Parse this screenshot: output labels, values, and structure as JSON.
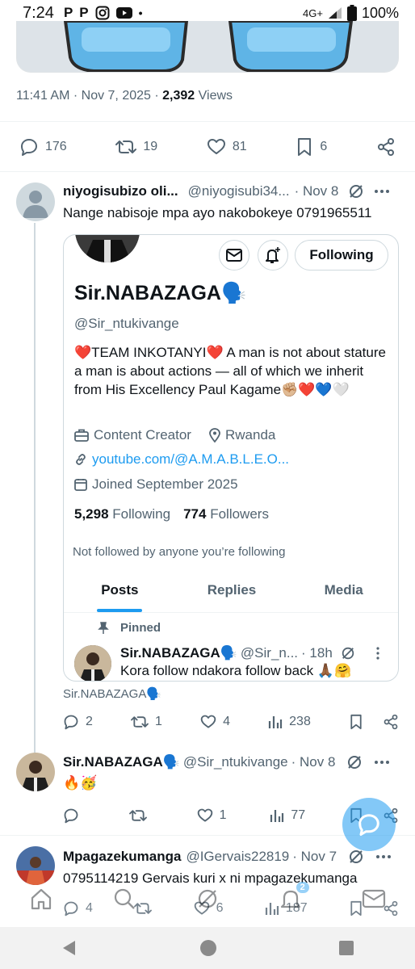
{
  "status_bar": {
    "time": "7:24",
    "app_icons": [
      "P",
      "P",
      "instagram-icon",
      "youtube-icon",
      "•"
    ],
    "network": "4G+",
    "battery": "100%"
  },
  "main_tweet": {
    "time": "11:41 AM · Nov 7, 2025 · ",
    "views_count": "2,392",
    "views_label": "Views",
    "actions": {
      "replies": "176",
      "retweets": "19",
      "likes": "81",
      "bookmarks": "6"
    }
  },
  "reply1": {
    "name": "niyogisubizo oli...",
    "handle": "@niyogisubi34...",
    "date": "· Nov 8",
    "text": "Nange nabisoje mpa ayo nakobokeye 0791965511",
    "card": {
      "following_button": "Following",
      "name": "Sir.NABAZAGA🗣️",
      "handle": "@Sir_ntukivange",
      "bio": "❤️TEAM INKOTANYI❤️  A man is not about stature a man is about actions — all of which we inherit from His Excellency Paul Kagame✊🏼❤️💙🤍",
      "category": "Content Creator",
      "location": "Rwanda",
      "link": "youtube.com/@A.M.A.B.L.E.O...",
      "joined": "Joined September 2025",
      "following_count": "5,298",
      "following_label": "Following",
      "followers_count": "774",
      "followers_label": "Followers",
      "not_followed": "Not followed by anyone you’re following",
      "tabs": [
        "Posts",
        "Replies",
        "Media"
      ],
      "pinned_label": "Pinned",
      "pinned_post": {
        "name": "Sir.NABAZAGA🗣️",
        "handle": "@Sir_n...",
        "time": "· 18h",
        "text": "Kora follow ndakora follow back 🙏🏾🤗"
      }
    },
    "caption": "Sir.NABAZAGA🗣️",
    "actions": {
      "replies": "2",
      "retweets": "1",
      "likes": "4",
      "views": "238"
    }
  },
  "reply2": {
    "name": "Sir.NABAZAGA🗣️",
    "handle": "@Sir_ntukivange",
    "date": "· Nov 8",
    "text": "🔥🥳",
    "actions": {
      "replies": "",
      "retweets": "",
      "likes": "1",
      "views": "77"
    }
  },
  "reply3": {
    "name": "Mpagazekumanga",
    "handle": "@IGervais22819",
    "date": "· Nov 7",
    "text": "0795114219 Gervais kuri x ni mpagazekumanga",
    "actions": {
      "replies": "4",
      "likes": "6",
      "views": "187"
    }
  },
  "bottom_nav": {
    "notifications_badge": "2"
  },
  "colors": {
    "accent": "#1d9bf0",
    "text": "#0f1419",
    "muted": "#536471",
    "like_heart": "#f91880"
  }
}
